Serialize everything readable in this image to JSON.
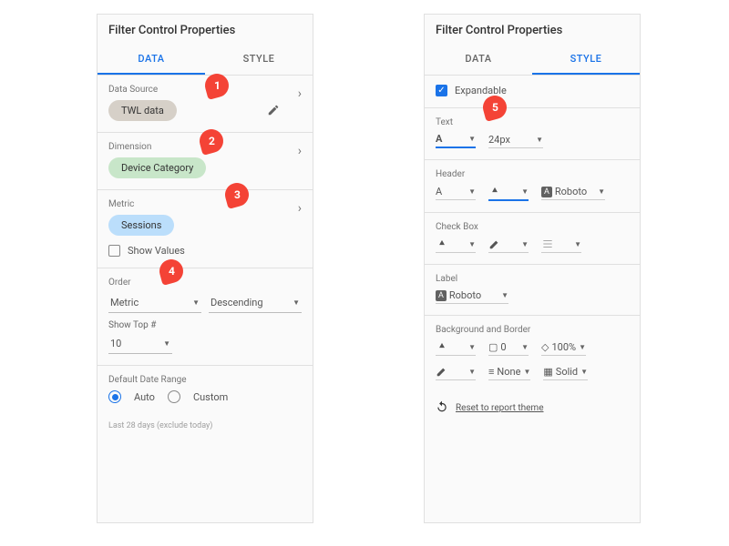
{
  "left": {
    "title": "Filter Control Properties",
    "tabs": {
      "data": "DATA",
      "style": "STYLE"
    },
    "dataSource": {
      "label": "Data Source",
      "value": "TWL data"
    },
    "dimension": {
      "label": "Dimension",
      "value": "Device Category"
    },
    "metric": {
      "label": "Metric",
      "value": "Sessions",
      "showValues": "Show Values"
    },
    "order": {
      "label": "Order",
      "by": "Metric",
      "dir": "Descending",
      "showTopLabel": "Show Top #",
      "showTop": "10"
    },
    "dateRange": {
      "label": "Default Date Range",
      "auto": "Auto",
      "custom": "Custom"
    },
    "footer": "Last 28 days (exclude today)"
  },
  "right": {
    "title": "Filter Control Properties",
    "tabs": {
      "data": "DATA",
      "style": "STYLE"
    },
    "expandable": "Expandable",
    "text": {
      "label": "Text",
      "size": "24px"
    },
    "header": {
      "label": "Header",
      "font": "Roboto"
    },
    "checkBox": {
      "label": "Check Box"
    },
    "labelSec": {
      "label": "Label",
      "font": "Roboto"
    },
    "bg": {
      "label": "Background and Border",
      "width": "0",
      "opacity": "100%",
      "stroke": "None",
      "style2": "Solid"
    },
    "reset": "Reset to report theme"
  },
  "badges": {
    "1": "1",
    "2": "2",
    "3": "3",
    "4": "4",
    "5": "5"
  }
}
